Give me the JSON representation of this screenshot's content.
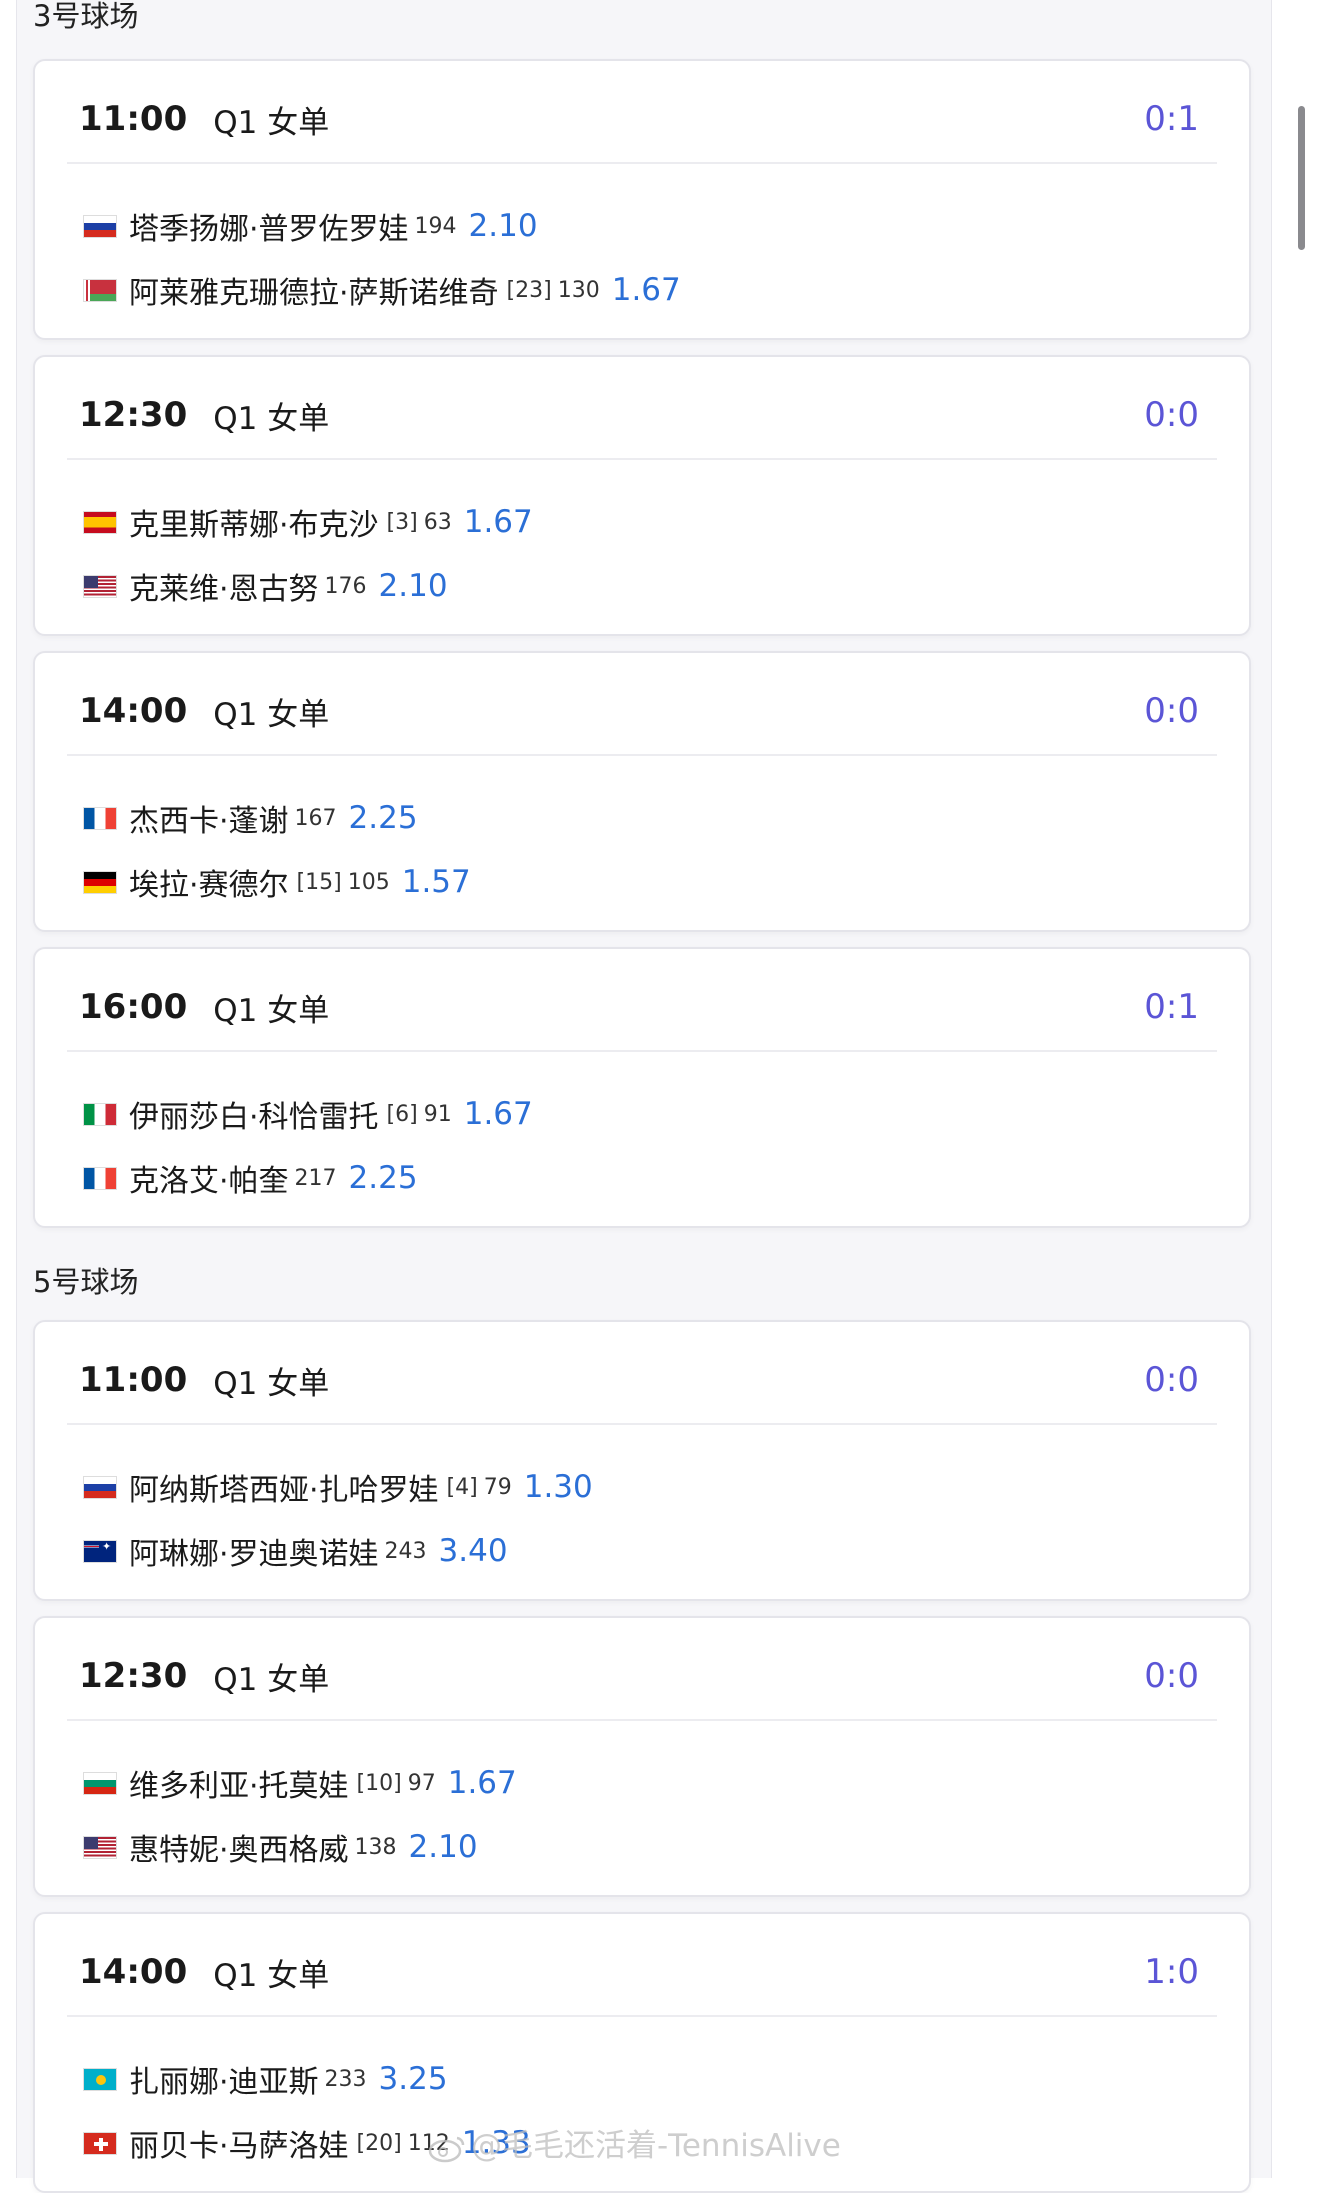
{
  "courts": [
    {
      "name": "3号球场",
      "matches": [
        {
          "time": "11:00",
          "round": "Q1 女单",
          "score": "0:1",
          "p1": {
            "flag": "russia",
            "name": "塔季扬娜·普罗佐罗娃",
            "seed": "",
            "rank": "194",
            "odds": "2.10"
          },
          "p2": {
            "flag": "belarus",
            "name": "阿莱雅克珊德拉·萨斯诺维奇",
            "seed": "[23]",
            "rank": "130",
            "odds": "1.67"
          }
        },
        {
          "time": "12:30",
          "round": "Q1 女单",
          "score": "0:0",
          "p1": {
            "flag": "spain",
            "name": "克里斯蒂娜·布克沙",
            "seed": "[3]",
            "rank": "63",
            "odds": "1.67"
          },
          "p2": {
            "flag": "usa",
            "name": "克莱维·恩古努",
            "seed": "",
            "rank": "176",
            "odds": "2.10"
          }
        },
        {
          "time": "14:00",
          "round": "Q1 女单",
          "score": "0:0",
          "p1": {
            "flag": "france",
            "name": "杰西卡·蓬谢",
            "seed": "",
            "rank": "167",
            "odds": "2.25"
          },
          "p2": {
            "flag": "germany",
            "name": "埃拉·赛德尔",
            "seed": "[15]",
            "rank": "105",
            "odds": "1.57"
          }
        },
        {
          "time": "16:00",
          "round": "Q1 女单",
          "score": "0:1",
          "p1": {
            "flag": "italy",
            "name": "伊丽莎白·科恰雷托",
            "seed": "[6]",
            "rank": "91",
            "odds": "1.67"
          },
          "p2": {
            "flag": "france",
            "name": "克洛艾·帕奎",
            "seed": "",
            "rank": "217",
            "odds": "2.25"
          }
        }
      ]
    },
    {
      "name": "5号球场",
      "matches": [
        {
          "time": "11:00",
          "round": "Q1 女单",
          "score": "0:0",
          "p1": {
            "flag": "russia",
            "name": "阿纳斯塔西娅·扎哈罗娃",
            "seed": "[4]",
            "rank": "79",
            "odds": "1.30"
          },
          "p2": {
            "flag": "australia",
            "name": "阿琳娜·罗迪奥诺娃",
            "seed": "",
            "rank": "243",
            "odds": "3.40"
          }
        },
        {
          "time": "12:30",
          "round": "Q1 女单",
          "score": "0:0",
          "p1": {
            "flag": "bulgaria",
            "name": "维多利亚·托莫娃",
            "seed": "[10]",
            "rank": "97",
            "odds": "1.67"
          },
          "p2": {
            "flag": "usa",
            "name": "惠特妮·奥西格威",
            "seed": "",
            "rank": "138",
            "odds": "2.10"
          }
        },
        {
          "time": "14:00",
          "round": "Q1 女单",
          "score": "1:0",
          "p1": {
            "flag": "kazakhstan",
            "name": "扎丽娜·迪亚斯",
            "seed": "",
            "rank": "233",
            "odds": "3.25"
          },
          "p2": {
            "flag": "switzerland",
            "name": "丽贝卡·马萨洛娃",
            "seed": "[20]",
            "rank": "112",
            "odds": "1.33"
          }
        }
      ]
    }
  ],
  "watermark": "@毛毛还活着-TennisAlive",
  "colors": {
    "score": "#5b55d6",
    "odds": "#2b6fd6"
  }
}
